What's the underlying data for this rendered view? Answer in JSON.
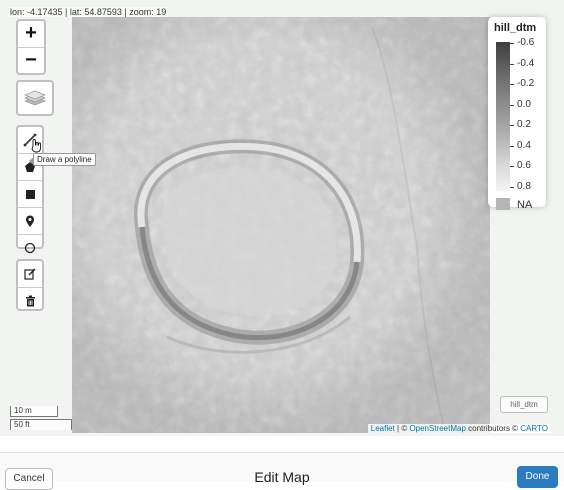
{
  "map": {
    "coords_readout": "lon: -4.17435 | lat: 54.87593 | zoom: 19",
    "zoom_in": "+",
    "zoom_out": "−",
    "tooltip": "Draw a polyline",
    "layer_toggle": "hill_dtm",
    "scale_metric": "10 m",
    "scale_imperial": "50 ft"
  },
  "legend": {
    "title": "hill_dtm",
    "labels": [
      "-0.6",
      "-0.4",
      "-0.2",
      "0.0",
      "0.2",
      "0.4",
      "0.6",
      "0.8"
    ],
    "na_label": "NA"
  },
  "attribution": {
    "leaflet": "Leaflet",
    "sep1": " | © ",
    "osm": "OpenStreetMap",
    "contrib": " contributors © ",
    "carto": "CARTO"
  },
  "footer": {
    "cancel": "Cancel",
    "title": "Edit Map",
    "done": "Done"
  },
  "icons": {
    "layers": "layers-icon",
    "polyline": "polyline-icon",
    "polygon": "polygon-icon",
    "rectangle": "rectangle-icon",
    "marker": "marker-icon",
    "circle": "circle-icon",
    "edit": "edit-icon",
    "delete": "trash-icon"
  }
}
